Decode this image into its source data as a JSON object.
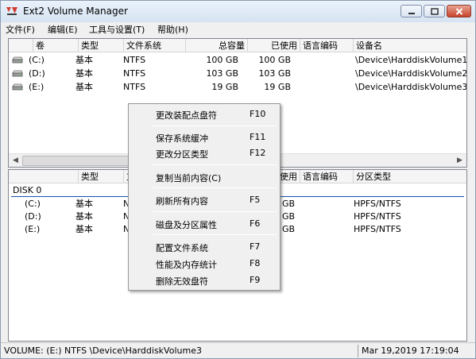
{
  "window": {
    "title": "Ext2 Volume Manager",
    "app_icon": "ext2-logo-icon"
  },
  "menu": [
    "文件(F)",
    "编辑(E)",
    "工具与设置(T)",
    "帮助(H)"
  ],
  "volumes": {
    "columns": [
      "卷",
      "类型",
      "文件系统",
      "总容量",
      "已使用",
      "语言编码",
      "设备名"
    ],
    "rows": [
      {
        "volume": "(C:)",
        "type": "基本",
        "fs": "NTFS",
        "total": "100 GB",
        "used": "100 GB",
        "codepage": "",
        "device": "\\Device\\HarddiskVolume1"
      },
      {
        "volume": "(D:)",
        "type": "基本",
        "fs": "NTFS",
        "total": "103 GB",
        "used": "103 GB",
        "codepage": "",
        "device": "\\Device\\HarddiskVolume2"
      },
      {
        "volume": "(E:)",
        "type": "基本",
        "fs": "NTFS",
        "total": "19 GB",
        "used": "19 GB",
        "codepage": "",
        "device": "\\Device\\HarddiskVolume3"
      }
    ]
  },
  "disks": {
    "columns": [
      "",
      "类型",
      "文",
      "使用",
      "语言编码",
      "分区类型"
    ],
    "disk_label": "DISK 0",
    "rows": [
      {
        "volume": "(C:)",
        "type": "基本",
        "fs": "N",
        "used": "GB",
        "codepage": "",
        "part_type": "HPFS/NTFS"
      },
      {
        "volume": "(D:)",
        "type": "基本",
        "fs": "N",
        "used": "GB",
        "codepage": "",
        "part_type": "HPFS/NTFS"
      },
      {
        "volume": "(E:)",
        "type": "基本",
        "fs": "N",
        "used": "GB",
        "codepage": "",
        "part_type": "HPFS/NTFS"
      }
    ]
  },
  "context_menu": {
    "items": [
      {
        "label": "更改装配点盘符",
        "shortcut": "F10"
      },
      {
        "label": "保存系统缓冲",
        "shortcut": "F11"
      },
      {
        "label": "更改分区类型",
        "shortcut": "F12"
      },
      {
        "label": "复制当前内容(C)",
        "shortcut": ""
      },
      {
        "label": "刷新所有内容",
        "shortcut": "F5"
      },
      {
        "label": "磁盘及分区属性",
        "shortcut": "F6"
      },
      {
        "label": "配置文件系统",
        "shortcut": "F7"
      },
      {
        "label": "性能及内存统计",
        "shortcut": "F8"
      },
      {
        "label": "删除无效盘符",
        "shortcut": "F9"
      }
    ]
  },
  "status": {
    "left": "VOLUME: (E:) NTFS \\Device\\HarddiskVolume3",
    "right": "Mar 19,2019 17:19:04"
  },
  "colors": {
    "accent_rule": "#1d4fa8",
    "close_button": "#c7432a"
  }
}
